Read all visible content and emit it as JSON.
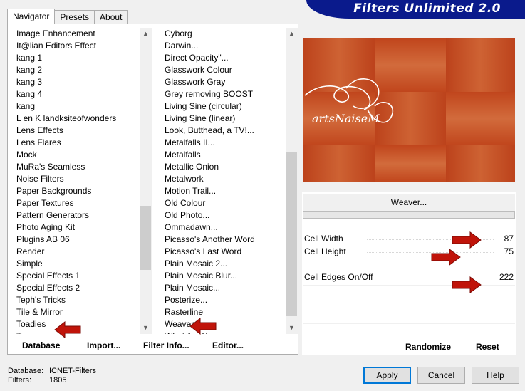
{
  "banner": {
    "title": "Filters Unlimited 2.0"
  },
  "tabs": [
    "Navigator",
    "Presets",
    "About"
  ],
  "categories": [
    "Image Enhancement",
    "It@lian Editors Effect",
    "kang 1",
    "kang 2",
    "kang 3",
    "kang 4",
    "kang",
    "L en K landksiteofwonders",
    "Lens Effects",
    "Lens Flares",
    "Mock",
    "MuRa's Seamless",
    "Noise Filters",
    "Paper Backgrounds",
    "Paper Textures",
    "Pattern Generators",
    "Photo Aging Kit",
    "Plugins AB 06",
    "Render",
    "Simple",
    "Special Effects 1",
    "Special Effects 2",
    "Teph's Tricks",
    "Tile & Mirror",
    "Toadies",
    "Transparency"
  ],
  "filters": [
    "Cyborg",
    "Darwin...",
    "Direct Opacity\"...",
    "Glasswork Colour",
    "Glasswork Gray",
    "Grey removing BOOST",
    "Living Sine (circular)",
    "Living Sine (linear)",
    "Look, Butthead, a TV!...",
    "Metalfalls II...",
    "Metalfalls",
    "Metallic Onion",
    "Metalwork",
    "Motion Trail...",
    "Old Colour",
    "Old Photo...",
    "Ommadawn...",
    "Picasso's Another Word",
    "Picasso's Last Word",
    "Plain Mosaic 2...",
    "Plain Mosaic Blur...",
    "Plain Mosaic...",
    "Posterize...",
    "Rasterline",
    "Weaver...",
    "What Are You..."
  ],
  "panel_buttons": {
    "database": "Database",
    "import": "Import...",
    "filter_info": "Filter Info...",
    "editor": "Editor..."
  },
  "preview": {
    "watermark": "artsNaiseM"
  },
  "filter_name": "Weaver...",
  "params": [
    {
      "label": "Cell Width",
      "value": "87"
    },
    {
      "label": "Cell Height",
      "value": "75"
    },
    {
      "label": "Cell Edges On/Off",
      "value": "222"
    }
  ],
  "right_buttons": {
    "randomize": "Randomize",
    "reset": "Reset"
  },
  "status": {
    "database_label": "Database:",
    "database_value": "ICNET-Filters",
    "filters_label": "Filters:",
    "filters_value": "1805"
  },
  "dialog_buttons": {
    "apply": "Apply",
    "cancel": "Cancel",
    "help": "Help"
  },
  "colors": {
    "banner": "#0a1a8c",
    "preview": "#c2461e",
    "arrow": "#c0140a",
    "focus": "#0078d7"
  }
}
